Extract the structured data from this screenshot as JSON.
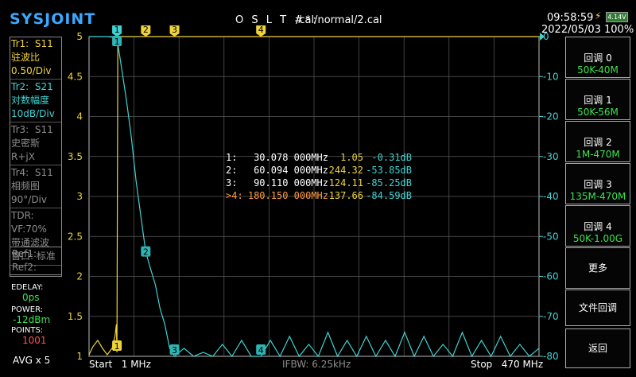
{
  "header": {
    "logo": "SYSJOINT",
    "cal_label": "O S L T #*:",
    "cal_file": "/cal/normal/2.cal",
    "time": "09:58:59",
    "battery_voltage": "4.14V",
    "date": "2022/05/03",
    "battery_percent": "100%"
  },
  "traces": [
    {
      "name": "Tr1:",
      "param": "S11",
      "format": "驻波比",
      "scale": "0.50/Div",
      "color": "#f0d43a",
      "active": true
    },
    {
      "name": "Tr2:",
      "param": "S21",
      "format": "对数幅度",
      "scale": "10dB/Div",
      "color": "#3fd3d3",
      "active": true
    },
    {
      "name": "Tr3:",
      "param": "S11",
      "format": "史密斯",
      "scale": "R+jX",
      "color": "#8d8d8d",
      "active": false
    },
    {
      "name": "Tr4:",
      "param": "S11",
      "format": "相频图",
      "scale": "90°/Div",
      "color": "#8d8d8d",
      "active": false
    }
  ],
  "tdr": {
    "title": "TDR:",
    "vf": "VF:70%",
    "filter": "带通滤波",
    "window": "窗口: 标准"
  },
  "refs": [
    "Ref1:",
    "Ref2:"
  ],
  "status": {
    "edelay_label": "EDELAY:",
    "edelay_value": "0ps",
    "power_label": "POWER:",
    "power_value": "-12dBm",
    "points_label": "POINTS:",
    "points_value": "1001",
    "avg": "AVG x 5"
  },
  "footer": {
    "start": "Start   1 MHz",
    "ifbw": "IFBW: 6.25kHz",
    "stop": "Stop   470 MHz"
  },
  "buttons": [
    {
      "label": "回调 0",
      "sub": "50K-40M"
    },
    {
      "label": "回调 1",
      "sub": "50K-56M"
    },
    {
      "label": "回调 2",
      "sub": "1M-470M"
    },
    {
      "label": "回调 3",
      "sub": "135M-470M"
    },
    {
      "label": "回调 4",
      "sub": "50K-1.00G"
    },
    {
      "label": "更多",
      "sub": ""
    },
    {
      "label": "文件回调",
      "sub": ""
    },
    {
      "label": "返回",
      "sub": ""
    }
  ],
  "markers": [
    {
      "id": "1:",
      "freq": "30.078 000MHz",
      "vswr": "1.05",
      "mag": "-0.31dB",
      "color": "#ffffff"
    },
    {
      "id": "2:",
      "freq": "60.094 000MHz",
      "vswr": "244.32",
      "mag": "-53.85dB",
      "color": "#ffffff"
    },
    {
      "id": "3:",
      "freq": "90.110 000MHz",
      "vswr": "124.11",
      "mag": "-85.25dB",
      "color": "#ffffff"
    },
    {
      "id": ">4:",
      "freq": "180.150 000MHz",
      "vswr": "137.66",
      "mag": "-84.59dB",
      "color": "#ff9a3c"
    }
  ],
  "chart_data": {
    "type": "line",
    "x_range_mhz": [
      1,
      470
    ],
    "left_axis": {
      "ticks": [
        "5",
        "4.5",
        "4",
        "3.5",
        "3",
        "2.5",
        "2",
        "1.5",
        "1"
      ],
      "range": [
        1,
        5
      ],
      "color": "#f0d43a"
    },
    "right_axis": {
      "ticks": [
        "0",
        "-10",
        "-20",
        "-30",
        "-40",
        "-50",
        "-60",
        "-70",
        "-80"
      ],
      "range": [
        -80,
        0
      ],
      "color": "#3fd3d3"
    },
    "grid": true,
    "series": [
      {
        "name": "S11",
        "color": "#f0d43a",
        "points": [
          [
            1,
            1.02
          ],
          [
            5,
            1.12
          ],
          [
            10,
            1.2
          ],
          [
            15,
            1.1
          ],
          [
            20,
            1.02
          ],
          [
            25,
            1.1
          ],
          [
            28,
            1.25
          ],
          [
            29.5,
            1.4
          ],
          [
            30.078,
            1.05
          ],
          [
            31,
            5
          ],
          [
            470,
            5
          ]
        ]
      },
      {
        "name": "S21",
        "color": "#3fd3d3",
        "points": [
          [
            1,
            0
          ],
          [
            20,
            0
          ],
          [
            28,
            -0.2
          ],
          [
            30.078,
            -0.31
          ],
          [
            35,
            -8
          ],
          [
            40,
            -16
          ],
          [
            45,
            -25
          ],
          [
            50,
            -36
          ],
          [
            55,
            -45
          ],
          [
            60.094,
            -53.85
          ],
          [
            65,
            -58
          ],
          [
            70,
            -62
          ],
          [
            75,
            -68
          ],
          [
            80,
            -72
          ],
          [
            85,
            -78
          ],
          [
            90.11,
            -80
          ],
          [
            100,
            -78
          ],
          [
            110,
            -80
          ],
          [
            120,
            -79
          ],
          [
            130,
            -80
          ],
          [
            140,
            -77
          ],
          [
            150,
            -80
          ],
          [
            160,
            -76
          ],
          [
            170,
            -80
          ],
          [
            180.15,
            -80
          ],
          [
            190,
            -76
          ],
          [
            200,
            -80
          ],
          [
            210,
            -75
          ],
          [
            220,
            -80
          ],
          [
            230,
            -77
          ],
          [
            240,
            -80
          ],
          [
            250,
            -74
          ],
          [
            260,
            -80
          ],
          [
            270,
            -76
          ],
          [
            280,
            -80
          ],
          [
            290,
            -75
          ],
          [
            300,
            -80
          ],
          [
            310,
            -76
          ],
          [
            320,
            -80
          ],
          [
            330,
            -74
          ],
          [
            340,
            -80
          ],
          [
            350,
            -75
          ],
          [
            360,
            -80
          ],
          [
            370,
            -77
          ],
          [
            380,
            -80
          ],
          [
            390,
            -74
          ],
          [
            400,
            -80
          ],
          [
            410,
            -76
          ],
          [
            420,
            -80
          ],
          [
            430,
            -75
          ],
          [
            440,
            -80
          ],
          [
            450,
            -77
          ],
          [
            460,
            -80
          ],
          [
            470,
            -78
          ]
        ]
      }
    ],
    "marker_positions": [
      {
        "label": "1",
        "x": 30.078,
        "s21": -0.31,
        "s11": 1.05
      },
      {
        "label": "2",
        "x": 60.094,
        "s21": -53.85
      },
      {
        "label": "3",
        "x": 90.11,
        "s21": -80
      },
      {
        "label": "4",
        "x": 180.15,
        "s21": -80
      }
    ]
  }
}
